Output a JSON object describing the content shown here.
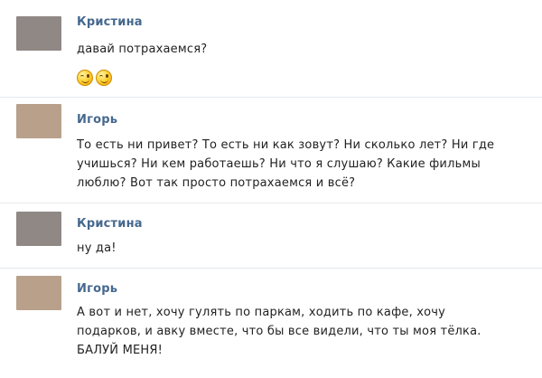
{
  "colors": {
    "author": "#45688e",
    "text": "#222222",
    "avatar_kristina": "#8f8885",
    "avatar_igor": "#b8a08a"
  },
  "messages": [
    {
      "author": "Кристина",
      "lines": [
        "давай потрахаемся?"
      ],
      "emoji": [
        "wink-emoji",
        "wink-emoji"
      ]
    },
    {
      "author": "Игорь",
      "lines": [
        "То есть ни привет? То есть ни как зовут? Ни сколько лет? Ни где",
        "учишься? Ни кем работаешь? Ни что я слушаю? Какие фильмы",
        "люблю? Вот так просто потрахаемся и всё?"
      ]
    },
    {
      "author": "Кристина",
      "lines": [
        "ну да!"
      ]
    },
    {
      "author": "Игорь",
      "lines": [
        "А вот и нет, хочу гулять по паркам, ходить по кафе, хочу",
        "подарков, и авку вместе, что бы все видели, что ты моя тёлка.",
        "БАЛУЙ МЕНЯ!"
      ]
    }
  ]
}
